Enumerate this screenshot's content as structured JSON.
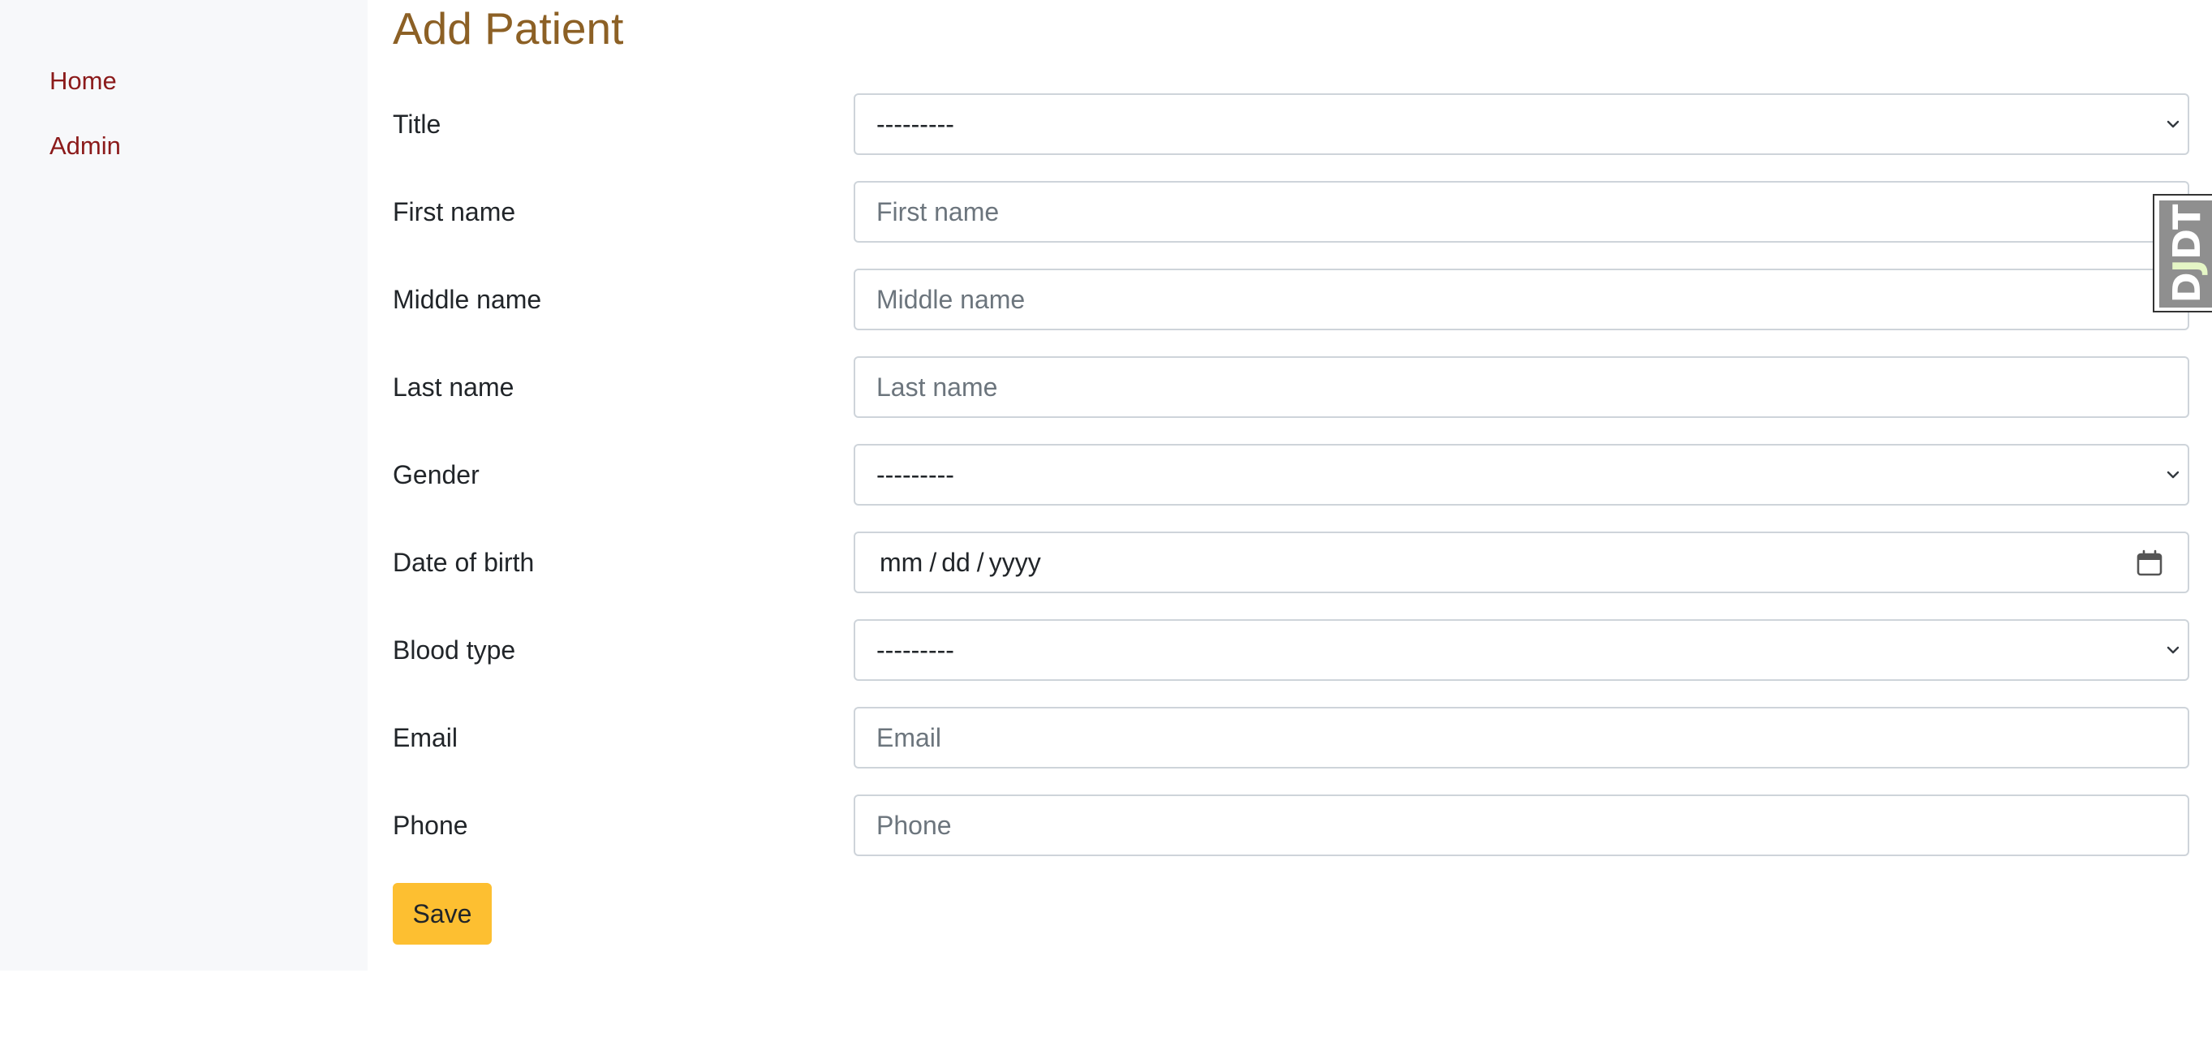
{
  "sidebar": {
    "items": [
      {
        "label": "Home"
      },
      {
        "label": "Admin"
      }
    ]
  },
  "page": {
    "title": "Add Patient"
  },
  "form": {
    "title": {
      "label": "Title",
      "value": "---------"
    },
    "first_name": {
      "label": "First name",
      "placeholder": "First name"
    },
    "middle_name": {
      "label": "Middle name",
      "placeholder": "Middle name"
    },
    "last_name": {
      "label": "Last name",
      "placeholder": "Last name"
    },
    "gender": {
      "label": "Gender",
      "value": "---------"
    },
    "date_of_birth": {
      "label": "Date of birth",
      "mm": "mm",
      "dd": "dd",
      "yyyy": "yyyy",
      "separator": "/"
    },
    "blood_type": {
      "label": "Blood type",
      "value": "---------"
    },
    "email": {
      "label": "Email",
      "placeholder": "Email"
    },
    "phone": {
      "label": "Phone",
      "placeholder": "Phone"
    },
    "save_label": "Save"
  },
  "debug_toolbar": {
    "handle_label_d": "D",
    "handle_label_j": "J",
    "handle_label_dt": "DT",
    "bg_color": "#8f8f8f",
    "accent_color": "#e5f6c5"
  },
  "colors": {
    "nav_link": "#8b1a1a",
    "title": "#8c6025",
    "save_button": "#fdbf31",
    "sidebar_bg": "#f7f8fa"
  },
  "icons": {
    "select_chevron": "chevron-down-icon",
    "date_picker": "calendar-icon"
  }
}
